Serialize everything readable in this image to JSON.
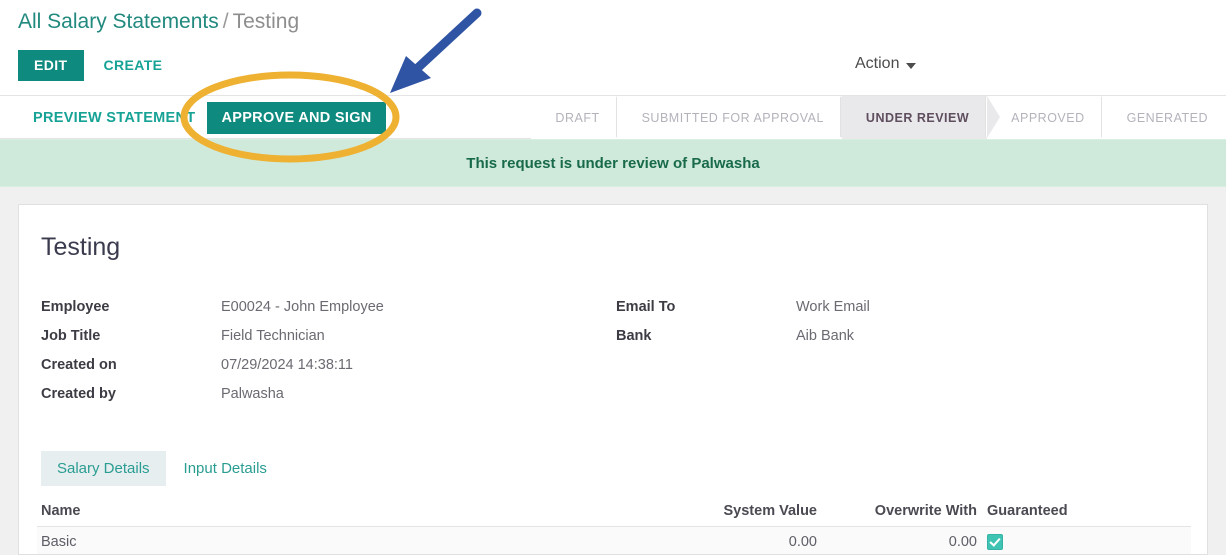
{
  "breadcrumb": {
    "parent": "All Salary Statements",
    "separator": "/",
    "current": "Testing"
  },
  "toolbar": {
    "edit_label": "EDIT",
    "create_label": "CREATE",
    "action_label": "Action",
    "action_caret_icon": "chevron-down-icon"
  },
  "control_panel": {
    "preview_label": "PREVIEW STATEMENT",
    "approve_label": "APPROVE AND SIGN"
  },
  "statusbar": {
    "stages": [
      {
        "label": "DRAFT",
        "active": false
      },
      {
        "label": "SUBMITTED FOR APPROVAL",
        "active": false
      },
      {
        "label": "UNDER REVIEW",
        "active": true
      },
      {
        "label": "APPROVED",
        "active": false
      },
      {
        "label": "GENERATED",
        "active": false
      }
    ]
  },
  "alert": {
    "message": "This request is under review of Palwasha"
  },
  "sheet": {
    "title": "Testing",
    "fields_left": [
      {
        "label": "Employee",
        "value": "E00024 - John Employee"
      },
      {
        "label": "Job Title",
        "value": "Field Technician"
      },
      {
        "label": "Created on",
        "value": "07/29/2024 14:38:11"
      },
      {
        "label": "Created by",
        "value": "Palwasha"
      }
    ],
    "fields_right": [
      {
        "label": "Email To",
        "value": "Work Email"
      },
      {
        "label": "Bank",
        "value": "Aib Bank"
      }
    ],
    "tabs": [
      {
        "label": "Salary Details",
        "active": true
      },
      {
        "label": "Input Details",
        "active": false
      }
    ],
    "table": {
      "columns": [
        "Name",
        "System Value",
        "Overwrite With",
        "Guaranteed"
      ],
      "rows": [
        {
          "name": "Basic",
          "system_value": "0.00",
          "overwrite_with": "0.00",
          "guaranteed": true
        }
      ]
    }
  },
  "annotations": {
    "highlight_ellipse_color": "#eab game",
    "ellipse_color": "#eeb132",
    "arrow_color": "#2f54a3"
  },
  "colors": {
    "brand_teal": "#0f8a7e",
    "link_teal": "#16a396",
    "alert_bg": "#cfeadb",
    "alert_text": "#186a4b",
    "active_stage_bg": "#e9e9ec",
    "checkbox_teal": "#3fc4b4"
  }
}
